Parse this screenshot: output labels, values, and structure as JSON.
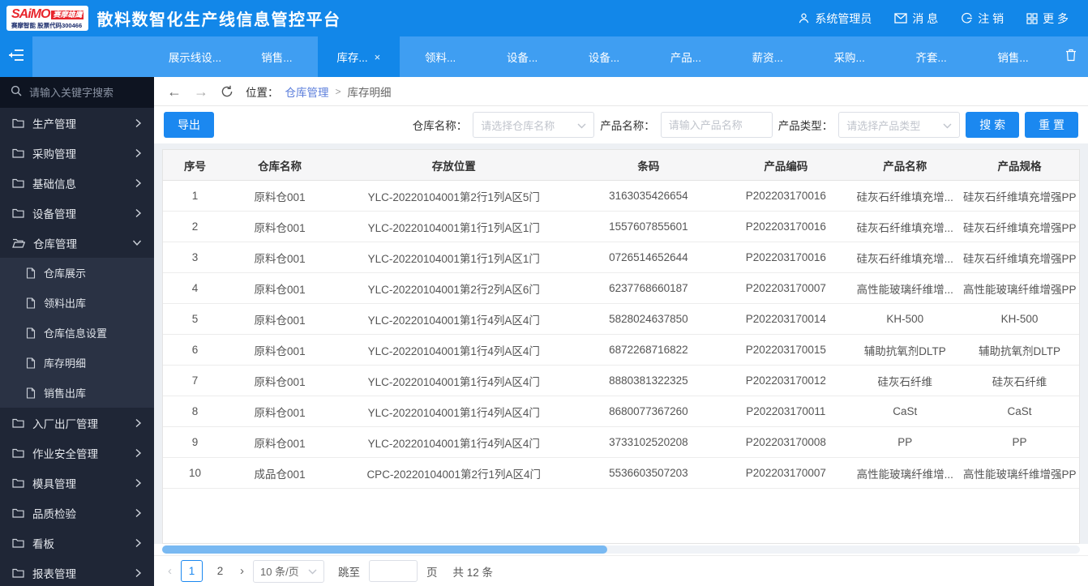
{
  "header": {
    "logo_saimo": "SAiMO",
    "logo_eagle": "赛摩雄鹰",
    "logo_sub": "赛摩智能 股票代码300466",
    "title": "散料数智化生产线信息管控平台",
    "user_label": "系统管理员",
    "messages_label": "消 息",
    "logout_label": "注 销",
    "more_label": "更 多"
  },
  "tabbar": {
    "tabs": [
      {
        "label": "展示线设...",
        "active": false,
        "closable": false
      },
      {
        "label": "销售...",
        "active": false,
        "closable": false
      },
      {
        "label": "库存...",
        "active": true,
        "closable": true
      },
      {
        "label": "领料...",
        "active": false,
        "closable": false
      },
      {
        "label": "设备...",
        "active": false,
        "closable": false
      },
      {
        "label": "设备...",
        "active": false,
        "closable": false
      },
      {
        "label": "产品...",
        "active": false,
        "closable": false
      },
      {
        "label": "薪资...",
        "active": false,
        "closable": false
      },
      {
        "label": "采购...",
        "active": false,
        "closable": false
      },
      {
        "label": "齐套...",
        "active": false,
        "closable": false
      },
      {
        "label": "销售...",
        "active": false,
        "closable": false
      }
    ]
  },
  "sidebar": {
    "search_placeholder": "请输入关键字搜索",
    "menu": [
      {
        "label": "生产管理",
        "state": "collapsed"
      },
      {
        "label": "采购管理",
        "state": "collapsed"
      },
      {
        "label": "基础信息",
        "state": "collapsed"
      },
      {
        "label": "设备管理",
        "state": "collapsed"
      },
      {
        "label": "仓库管理",
        "state": "expanded",
        "children": [
          "仓库展示",
          "领料出库",
          "仓库信息设置",
          "库存明细",
          "销售出库"
        ]
      },
      {
        "label": "入厂出厂管理",
        "state": "collapsed"
      },
      {
        "label": "作业安全管理",
        "state": "collapsed"
      },
      {
        "label": "模具管理",
        "state": "collapsed"
      },
      {
        "label": "品质检验",
        "state": "collapsed"
      },
      {
        "label": "看板",
        "state": "collapsed"
      },
      {
        "label": "报表管理",
        "state": "collapsed"
      }
    ]
  },
  "breadcrumb": {
    "location_label": "位置：",
    "parent": "仓库管理",
    "separator": ">",
    "current": "库存明细"
  },
  "filters": {
    "export_label": "导出",
    "warehouse_label": "仓库名称：",
    "warehouse_placeholder": "请选择仓库名称",
    "product_name_label": "产品名称：",
    "product_name_placeholder": "请输入产品名称",
    "product_type_label": "产品类型：",
    "product_type_placeholder": "请选择产品类型",
    "search_label": "搜 索",
    "reset_label": "重 置"
  },
  "table": {
    "headers": [
      "序号",
      "仓库名称",
      "存放位置",
      "条码",
      "产品编码",
      "产品名称",
      "产品规格"
    ],
    "rows": [
      [
        "1",
        "原料仓001",
        "YLC-20220104001第2行1列A区5门",
        "3163035426654",
        "P202203170016",
        "硅灰石纤维填充增...",
        "硅灰石纤维填充增强PP"
      ],
      [
        "2",
        "原料仓001",
        "YLC-20220104001第1行1列A区1门",
        "1557607855601",
        "P202203170016",
        "硅灰石纤维填充增...",
        "硅灰石纤维填充增强PP"
      ],
      [
        "3",
        "原料仓001",
        "YLC-20220104001第1行1列A区1门",
        "0726514652644",
        "P202203170016",
        "硅灰石纤维填充增...",
        "硅灰石纤维填充增强PP"
      ],
      [
        "4",
        "原料仓001",
        "YLC-20220104001第2行2列A区6门",
        "6237768660187",
        "P202203170007",
        "高性能玻璃纤维增...",
        "高性能玻璃纤维增强PP"
      ],
      [
        "5",
        "原料仓001",
        "YLC-20220104001第1行4列A区4门",
        "5828024637850",
        "P202203170014",
        "KH-500",
        "KH-500"
      ],
      [
        "6",
        "原料仓001",
        "YLC-20220104001第1行4列A区4门",
        "6872268716822",
        "P202203170015",
        "辅助抗氧剂DLTP",
        "辅助抗氧剂DLTP"
      ],
      [
        "7",
        "原料仓001",
        "YLC-20220104001第1行4列A区4门",
        "8880381322325",
        "P202203170012",
        "硅灰石纤维",
        "硅灰石纤维"
      ],
      [
        "8",
        "原料仓001",
        "YLC-20220104001第1行4列A区4门",
        "8680077367260",
        "P202203170011",
        "CaSt",
        "CaSt"
      ],
      [
        "9",
        "原料仓001",
        "YLC-20220104001第1行4列A区4门",
        "3733102520208",
        "P202203170008",
        "PP",
        "PP"
      ],
      [
        "10",
        "成品仓001",
        "CPC-20220104001第2行1列A区4门",
        "5536603507203",
        "P202203170007",
        "高性能玻璃纤维增...",
        "高性能玻璃纤维增强PP"
      ]
    ]
  },
  "pagination": {
    "prev_label": "‹",
    "next_label": "›",
    "pages": [
      "1",
      "2"
    ],
    "current_page": "1",
    "page_size": "10 条/页",
    "jump_label": "跳至",
    "page_unit": "页",
    "total": "共 12 条"
  },
  "colors": {
    "header_blue": "#1287e9",
    "tabbar_blue": "#3f9ef2",
    "primary_button_blue": "#1b88f0",
    "sidebar_bg": "#1f2636",
    "submenu_bg": "#2a3244",
    "link_blue": "#5a7ddb",
    "scrollbar_thumb_blue": "#79b9f2"
  }
}
